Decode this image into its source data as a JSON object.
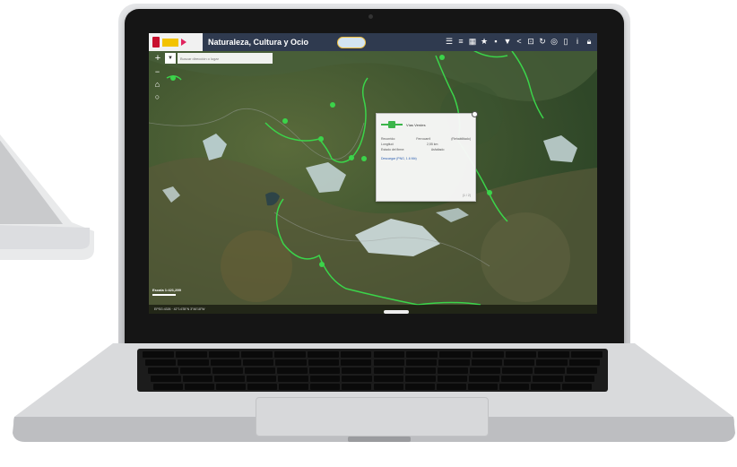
{
  "app": {
    "title": "Naturaleza, Cultura y Ocio",
    "search_placeholder": "Buscar dirección o lugar",
    "layer_select_icon": "chevron-down-icon",
    "toolbar_icons": [
      "layers-icon",
      "list-icon",
      "grid-icon",
      "star-icon",
      "print-icon",
      "download-icon",
      "share-icon",
      "measure-icon",
      "refresh-icon",
      "location-icon",
      "mobile-icon",
      "info-icon",
      "lock-icon",
      "close-icon"
    ],
    "side_buttons": [
      "zoom-out-icon",
      "home-icon",
      "location-icon"
    ]
  },
  "popup": {
    "name": "Vías Verdes",
    "rows": [
      {
        "label": "Recorrido:",
        "value_a": "Ferrocarril",
        "value_b": "(Rehabilitado)"
      },
      {
        "label": "Longitud:",
        "value_a": "2,55 km",
        "value_b": ""
      },
      {
        "label": "Estado del firme:",
        "value_a": "Asfaltado",
        "value_b": ""
      }
    ],
    "link": "Descargar (PNG, 1.6 Mb)",
    "footer": "(1 / 2)"
  },
  "map": {
    "scale_label": "Escala 1:421,299",
    "coords_label": "EPSG:4326 · 42°14'35\"N 3°46'18\"W",
    "route_color": "#3bd44a",
    "header_color": "#2f3a4f"
  }
}
